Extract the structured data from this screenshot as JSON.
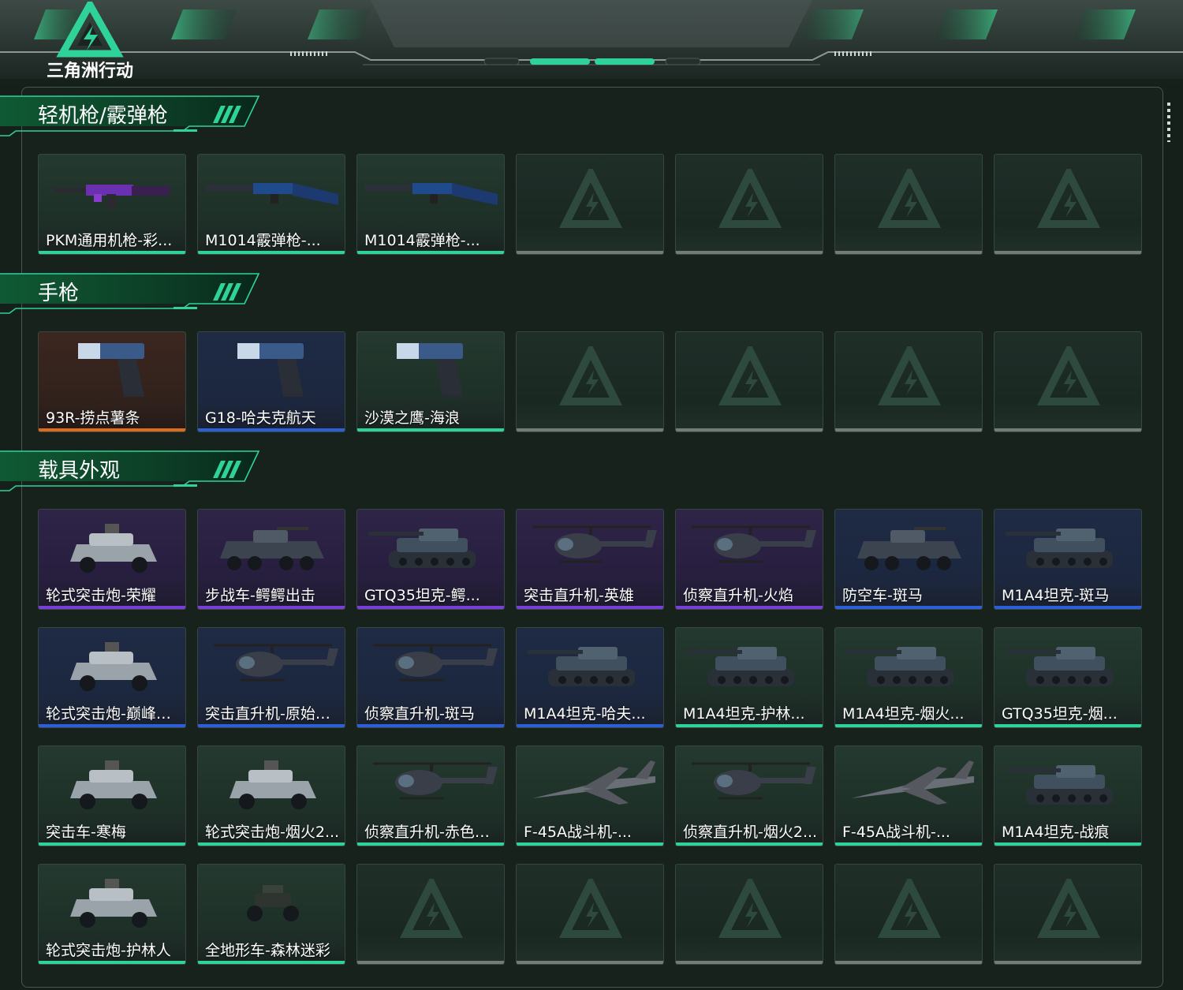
{
  "header": {
    "logo_text": "三角洲行动",
    "colors": {
      "accent": "#2fd39a",
      "dark": "#141c18"
    }
  },
  "rarity_colors": {
    "green": "#2fd39a",
    "blue": "#2d5fd8",
    "purple": "#7a3fd8",
    "orange": "#e06a1c",
    "empty": "#8a8f8c"
  },
  "sections": [
    {
      "title": "轻机枪/霰弹枪",
      "rows": [
        [
          {
            "label": "PKM通用机枪-彩...",
            "rarity": "green",
            "icon": "machine-gun-icon",
            "bg": "green"
          },
          {
            "label": "M1014霰弹枪-...",
            "rarity": "green",
            "icon": "shotgun-icon",
            "bg": "green"
          },
          {
            "label": "M1014霰弹枪-...",
            "rarity": "green",
            "icon": "shotgun-icon",
            "bg": "green"
          },
          {
            "label": "",
            "rarity": "empty"
          },
          {
            "label": "",
            "rarity": "empty"
          },
          {
            "label": "",
            "rarity": "empty"
          },
          {
            "label": "",
            "rarity": "empty"
          }
        ]
      ]
    },
    {
      "title": "手枪",
      "rows": [
        [
          {
            "label": "93R-捞点薯条",
            "rarity": "orange",
            "icon": "pistol-icon",
            "bg": "orange"
          },
          {
            "label": "G18-哈夫克航天",
            "rarity": "blue",
            "icon": "pistol-icon",
            "bg": "blue"
          },
          {
            "label": "沙漠之鹰-海浪",
            "rarity": "green",
            "icon": "pistol-icon",
            "bg": "green"
          },
          {
            "label": "",
            "rarity": "empty"
          },
          {
            "label": "",
            "rarity": "empty"
          },
          {
            "label": "",
            "rarity": "empty"
          },
          {
            "label": "",
            "rarity": "empty"
          }
        ]
      ]
    },
    {
      "title": "载具外观",
      "rows": [
        [
          {
            "label": "轮式突击炮-荣耀",
            "rarity": "purple",
            "icon": "armored-car-icon",
            "bg": "purple"
          },
          {
            "label": "步战车-鳄鳄出击",
            "rarity": "purple",
            "icon": "apc-icon",
            "bg": "purple"
          },
          {
            "label": "GTQ35坦克-鳄...",
            "rarity": "purple",
            "icon": "tank-icon",
            "bg": "purple"
          },
          {
            "label": "突击直升机-英雄",
            "rarity": "purple",
            "icon": "helicopter-icon",
            "bg": "purple"
          },
          {
            "label": "侦察直升机-火焰",
            "rarity": "purple",
            "icon": "helicopter-icon",
            "bg": "purple"
          },
          {
            "label": "防空车-斑马",
            "rarity": "blue",
            "icon": "apc-icon",
            "bg": "blue"
          },
          {
            "label": "M1A4坦克-斑马",
            "rarity": "blue",
            "icon": "tank-icon",
            "bg": "blue"
          }
        ],
        [
          {
            "label": "轮式突击炮-巅峰竞...",
            "rarity": "blue",
            "icon": "armored-car-icon",
            "bg": "blue"
          },
          {
            "label": "突击直升机-原始伪...",
            "rarity": "blue",
            "icon": "helicopter-icon",
            "bg": "blue"
          },
          {
            "label": "侦察直升机-斑马",
            "rarity": "blue",
            "icon": "helicopter-icon",
            "bg": "blue"
          },
          {
            "label": "M1A4坦克-哈夫...",
            "rarity": "blue",
            "icon": "tank-icon",
            "bg": "blue"
          },
          {
            "label": "M1A4坦克-护林...",
            "rarity": "green",
            "icon": "tank-icon",
            "bg": "green"
          },
          {
            "label": "M1A4坦克-烟火...",
            "rarity": "green",
            "icon": "tank-icon",
            "bg": "green"
          },
          {
            "label": "GTQ35坦克-烟...",
            "rarity": "green",
            "icon": "tank-icon",
            "bg": "green"
          }
        ],
        [
          {
            "label": "突击车-寒梅",
            "rarity": "green",
            "icon": "armored-car-icon",
            "bg": "green"
          },
          {
            "label": "轮式突击炮-烟火2...",
            "rarity": "green",
            "icon": "armored-car-icon",
            "bg": "green"
          },
          {
            "label": "侦察直升机-赤色军...",
            "rarity": "green",
            "icon": "helicopter-icon",
            "bg": "green"
          },
          {
            "label": "F-45A战斗机-...",
            "rarity": "green",
            "icon": "jet-icon",
            "bg": "green"
          },
          {
            "label": "侦察直升机-烟火2...",
            "rarity": "green",
            "icon": "helicopter-icon",
            "bg": "green"
          },
          {
            "label": "F-45A战斗机-...",
            "rarity": "green",
            "icon": "jet-icon",
            "bg": "green"
          },
          {
            "label": "M1A4坦克-战痕",
            "rarity": "green",
            "icon": "tank-icon",
            "bg": "green"
          }
        ],
        [
          {
            "label": "轮式突击炮-护林人",
            "rarity": "green",
            "icon": "armored-car-icon",
            "bg": "green"
          },
          {
            "label": "全地形车-森林迷彩",
            "rarity": "green",
            "icon": "atv-icon",
            "bg": "green"
          },
          {
            "label": "",
            "rarity": "empty"
          },
          {
            "label": "",
            "rarity": "empty"
          },
          {
            "label": "",
            "rarity": "empty"
          },
          {
            "label": "",
            "rarity": "empty"
          },
          {
            "label": "",
            "rarity": "empty"
          }
        ]
      ]
    }
  ]
}
